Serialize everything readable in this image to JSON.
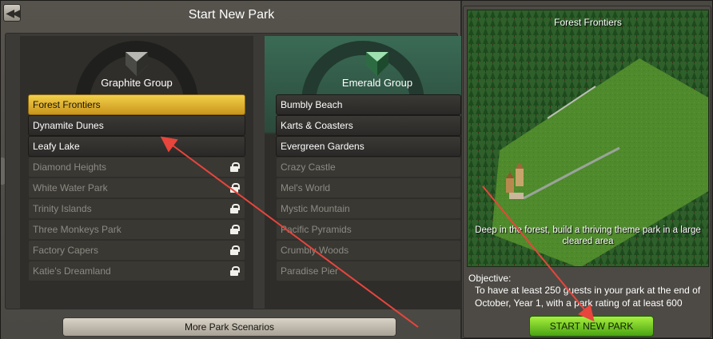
{
  "window": {
    "title": "Start New Park"
  },
  "groups": [
    {
      "name": "Graphite Group",
      "badge_color": "#5a5a56",
      "scenarios": [
        {
          "label": "Forest Frontiers",
          "state": "selected"
        },
        {
          "label": "Dynamite Dunes",
          "state": "normal"
        },
        {
          "label": "Leafy Lake",
          "state": "normal"
        },
        {
          "label": "Diamond Heights",
          "state": "locked"
        },
        {
          "label": "White Water Park",
          "state": "locked"
        },
        {
          "label": "Trinity Islands",
          "state": "locked"
        },
        {
          "label": "Three Monkeys Park",
          "state": "locked"
        },
        {
          "label": "Factory Capers",
          "state": "locked"
        },
        {
          "label": "Katie's Dreamland",
          "state": "locked"
        }
      ]
    },
    {
      "name": "Emerald Group",
      "badge_color": "#3f8f5a",
      "scenarios": [
        {
          "label": "Bumbly Beach",
          "state": "normal"
        },
        {
          "label": "Karts & Coasters",
          "state": "normal"
        },
        {
          "label": "Evergreen Gardens",
          "state": "normal"
        },
        {
          "label": "Crazy Castle",
          "state": "locked"
        },
        {
          "label": "Mel's World",
          "state": "locked"
        },
        {
          "label": "Mystic Mountain",
          "state": "locked"
        },
        {
          "label": "Pacific Pyramids",
          "state": "locked"
        },
        {
          "label": "Crumbly Woods",
          "state": "locked"
        },
        {
          "label": "Paradise Pier",
          "state": "locked"
        }
      ]
    }
  ],
  "more_button_label": "More Park Scenarios",
  "preview": {
    "title": "Forest Frontiers",
    "description": "Deep in the forest, build a thriving theme park in a large cleared area"
  },
  "objective": {
    "label": "Objective:",
    "text": "To have at least 250 guests in your park at the end of October, Year 1, with a park rating of at least 600"
  },
  "start_button_label": "START NEW PARK",
  "annotation_color": "#e8453c"
}
